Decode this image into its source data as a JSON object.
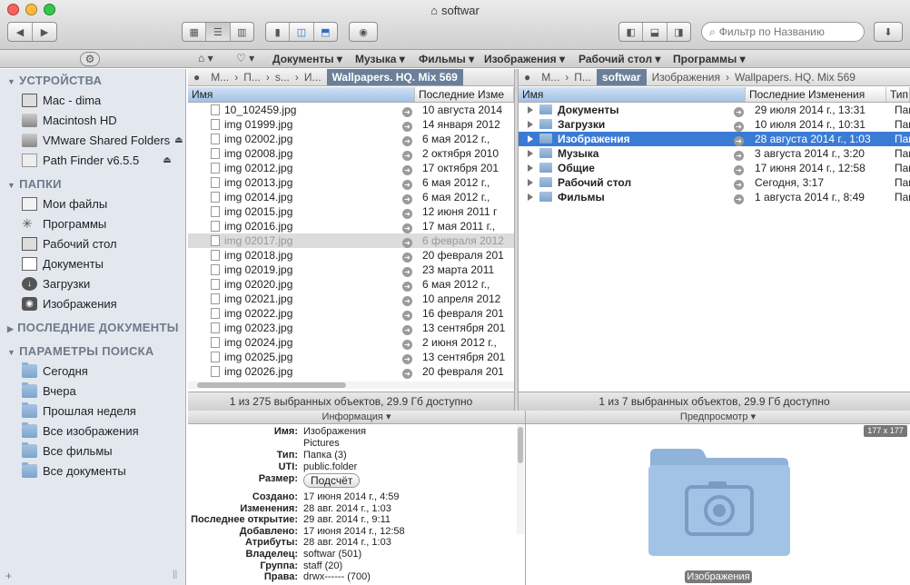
{
  "window": {
    "title": "softwar"
  },
  "toolbar": {
    "search_placeholder": "Фильтр по Названию"
  },
  "favbar": {
    "items": [
      "Документы",
      "Музыка",
      "Фильмы",
      "Изображения",
      "Рабочий стол",
      "Программы"
    ]
  },
  "sidebar": {
    "sections": [
      {
        "title": "УСТРОЙСТВА",
        "items": [
          "Mac - dima",
          "Macintosh HD",
          "VMware Shared Folders",
          "Path Finder v6.5.5"
        ]
      },
      {
        "title": "ПАПКИ",
        "items": [
          "Мои файлы",
          "Программы",
          "Рабочий стол",
          "Документы",
          "Загрузки",
          "Изображения"
        ]
      },
      {
        "title": "ПОСЛЕДНИЕ ДОКУМЕНТЫ",
        "items": []
      },
      {
        "title": "ПАРАМЕТРЫ ПОИСКА",
        "items": [
          "Сегодня",
          "Вчера",
          "Прошлая неделя",
          "Все изображения",
          "Все фильмы",
          "Все документы"
        ]
      }
    ]
  },
  "left_pane": {
    "path": [
      "М...",
      "П...",
      "s...",
      "И...",
      "Wallpapers. HQ. Mix 569"
    ],
    "columns": [
      "Имя",
      "Последние Изме"
    ],
    "rows": [
      {
        "name": "10_102459.jpg",
        "date": "10 августа 2014"
      },
      {
        "name": "img 01999.jpg",
        "date": "14 января 2012"
      },
      {
        "name": "img 02002.jpg",
        "date": "6 мая 2012 г.,"
      },
      {
        "name": "img 02008.jpg",
        "date": "2 октября 2010"
      },
      {
        "name": "img 02012.jpg",
        "date": "17 октября 201"
      },
      {
        "name": "img 02013.jpg",
        "date": "6 мая 2012 г.,"
      },
      {
        "name": "img 02014.jpg",
        "date": "6 мая 2012 г.,"
      },
      {
        "name": "img 02015.jpg",
        "date": "12 июня 2011 г"
      },
      {
        "name": "img 02016.jpg",
        "date": "17 мая 2011 г.,"
      },
      {
        "name": "img 02017.jpg",
        "date": "6 февраля 2012"
      },
      {
        "name": "img 02018.jpg",
        "date": "20 февраля 201"
      },
      {
        "name": "img 02019.jpg",
        "date": "23 марта 2011"
      },
      {
        "name": "img 02020.jpg",
        "date": "6 мая 2012 г.,"
      },
      {
        "name": "img 02021.jpg",
        "date": "10 апреля 2012"
      },
      {
        "name": "img 02022.jpg",
        "date": "16 февраля 201"
      },
      {
        "name": "img 02023.jpg",
        "date": "13 сентября 201"
      },
      {
        "name": "img 02024.jpg",
        "date": "2 июня 2012 г.,"
      },
      {
        "name": "img 02025.jpg",
        "date": "13 сентября 201"
      },
      {
        "name": "img 02026.jpg",
        "date": "20 февраля 201"
      }
    ],
    "status": "1 из 275 выбранных объектов, 29.9 Гб доступно"
  },
  "right_pane": {
    "path": [
      "М...",
      "П...",
      "softwar",
      "Изображения",
      "Wallpapers. HQ. Mix 569"
    ],
    "columns": [
      "Имя",
      "Последние Изменения",
      "Тип"
    ],
    "rows": [
      {
        "name": "Документы",
        "date": "29 июля 2014 г., 13:31",
        "type": "Пап"
      },
      {
        "name": "Загрузки",
        "date": "10 июля 2014 г., 10:31",
        "type": "Пап"
      },
      {
        "name": "Изображения",
        "date": "28 августа 2014 г., 1:03",
        "type": "Пап"
      },
      {
        "name": "Музыка",
        "date": "3 августа 2014 г., 3:20",
        "type": "Пап"
      },
      {
        "name": "Общие",
        "date": "17 июня 2014 г., 12:58",
        "type": "Пап"
      },
      {
        "name": "Рабочий стол",
        "date": "Сегодня, 3:17",
        "type": "Пап"
      },
      {
        "name": "Фильмы",
        "date": "1 августа 2014 г., 8:49",
        "type": "Пап"
      }
    ],
    "status": "1 из 7 выбранных объектов, 29.9 Гб доступно"
  },
  "info": {
    "title": "Информация",
    "fields": [
      {
        "k": "Имя:",
        "v": "Изображения"
      },
      {
        "k": "",
        "v": "Pictures"
      },
      {
        "k": "Тип:",
        "v": "Папка (3)"
      },
      {
        "k": "UTI:",
        "v": "public.folder"
      },
      {
        "k": "Размер:",
        "v": "Подсчёт"
      },
      {
        "k": "Создано:",
        "v": "17 июня 2014 г., 4:59"
      },
      {
        "k": "Изменения:",
        "v": "28 авг. 2014 г., 1:03"
      },
      {
        "k": "Последнее открытие:",
        "v": "29 авг. 2014 г., 9:11"
      },
      {
        "k": "Добавлено:",
        "v": "17 июня 2014 г., 12:58"
      },
      {
        "k": "Атрибуты:",
        "v": "28 авг. 2014 г., 1:03"
      },
      {
        "k": "Владелец:",
        "v": "softwar (501)"
      },
      {
        "k": "Группа:",
        "v": "staff (20)"
      },
      {
        "k": "Права:",
        "v": "drwx------ (700)"
      }
    ]
  },
  "preview": {
    "title": "Предпросмотр",
    "size_badge": "177 x 177",
    "caption": "Изображения"
  }
}
